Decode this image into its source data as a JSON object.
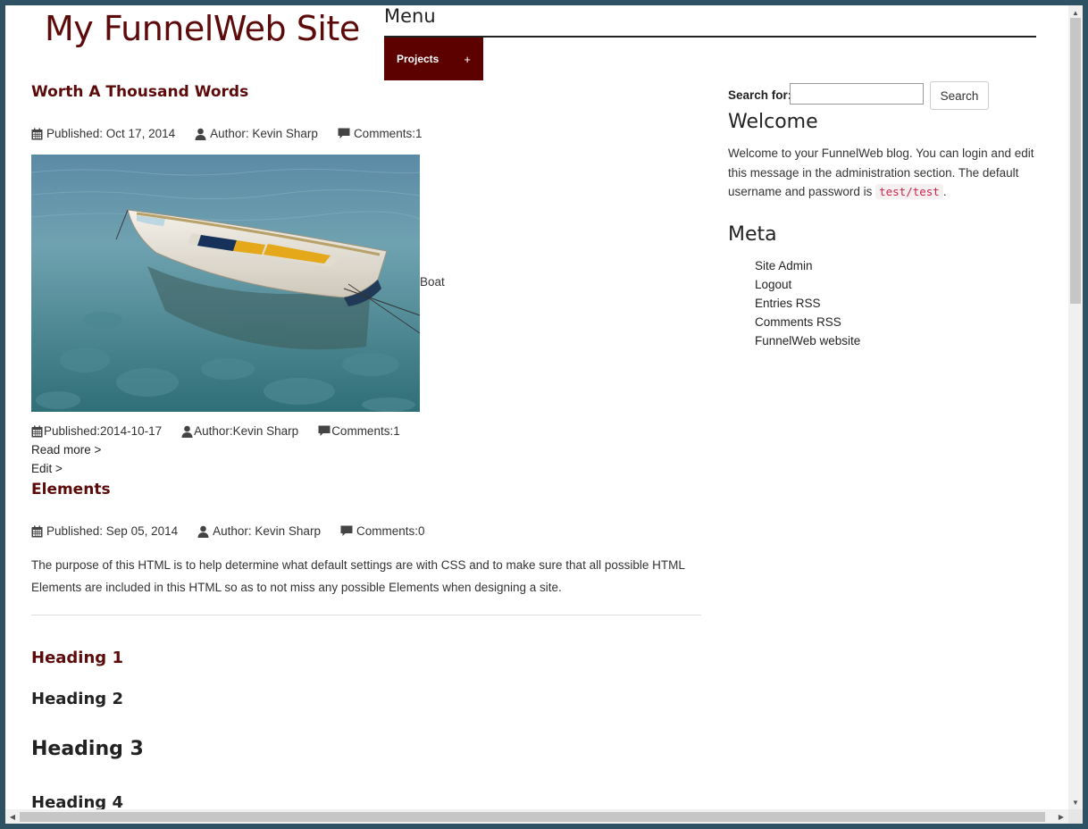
{
  "site": {
    "title": "My FunnelWeb Site"
  },
  "menu": {
    "heading": "Menu",
    "projects_label": "Projects",
    "projects_toggle": "+"
  },
  "posts": [
    {
      "title": "Worth A Thousand Words",
      "meta": {
        "published": "Published: Oct 17, 2014",
        "author": "Author: Kevin Sharp",
        "comments": "Comments:1"
      },
      "image_caption": "Boat",
      "meta2": {
        "published": "Published:2014-10-17",
        "author": "Author:Kevin Sharp",
        "comments": "Comments:1"
      },
      "read_more": "Read more >",
      "edit": "Edit >"
    },
    {
      "title": "Elements",
      "meta": {
        "published": "Published: Sep 05, 2014",
        "author": "Author: Kevin Sharp",
        "comments": "Comments:0"
      },
      "body": "The purpose of this HTML is to help determine what default settings are with CSS and to make sure that all possible HTML Elements are included in this HTML so as to not miss any possible Elements when designing a site.",
      "headings": [
        "Heading 1",
        "Heading 2",
        "Heading 3",
        "Heading 4"
      ]
    }
  ],
  "sidebar": {
    "search_label": "Search for:",
    "search_value": "",
    "search_button": "Search",
    "welcome_heading": "Welcome",
    "welcome_text_before": "Welcome to your FunnelWeb blog. You can login and edit this message in the administration section. The default username and password is ",
    "welcome_code": "test/test",
    "welcome_text_after": ".",
    "meta_heading": "Meta",
    "meta_links": [
      "Site Admin",
      "Logout",
      "Entries RSS",
      "Comments RSS",
      "FunnelWeb website"
    ]
  },
  "colors": {
    "brand": "#5c0a0a",
    "menu_bg": "#5c0000",
    "frame": "#2f5164"
  },
  "icons": [
    "calendar-icon",
    "user-icon",
    "comment-icon"
  ]
}
